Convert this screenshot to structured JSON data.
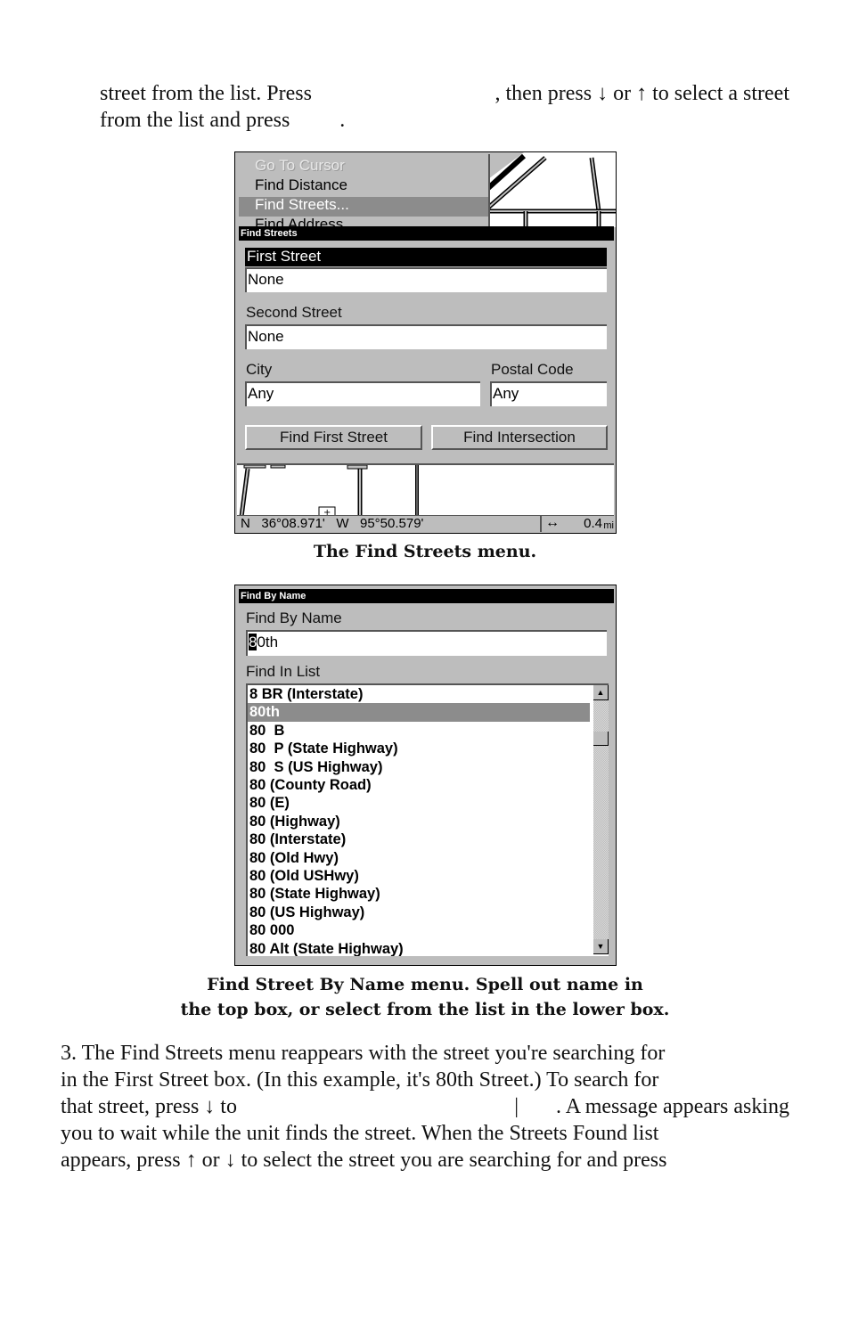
{
  "intro": {
    "line1_left": "street from the list. Press",
    "line1_right": ", then press ↓ or ↑ to select a street",
    "line2": "from the list and press",
    "line2_end": "."
  },
  "find_streets_screen": {
    "popup_menu": {
      "items": [
        {
          "label": "Go To Cursor",
          "state": "disabled"
        },
        {
          "label": "Find Distance",
          "state": "normal"
        },
        {
          "label": "Find Streets...",
          "state": "selected"
        },
        {
          "label": "Find Address",
          "state": "partially-hidden"
        }
      ]
    },
    "dialog_title": "Find Streets",
    "first_street_label": "First Street",
    "first_street_value": "None",
    "second_street_label": "Second Street",
    "second_street_value": "None",
    "city_label": "City",
    "city_value": "Any",
    "postal_code_label": "Postal Code",
    "postal_code_value": "Any",
    "find_first_street_button": "Find First Street",
    "find_intersection_button": "Find Intersection",
    "status": {
      "lat_hemisphere": "N",
      "latitude": "36°08.971'",
      "lon_hemisphere": "W",
      "longitude": "95°50.579'",
      "zoom_icon": "horizontal-double-arrow",
      "zoom_value": "0.4",
      "zoom_unit": "mi"
    }
  },
  "caption1": "The Find Streets menu.",
  "find_by_name_screen": {
    "dialog_title": "Find By Name",
    "find_by_name_label": "Find By Name",
    "find_by_name_cursor_char": "8",
    "find_by_name_rest": "0th",
    "find_in_list_label": "Find In List",
    "list_items": [
      "8 BR (Interstate)",
      "80th",
      "80  B",
      "80  P (State Highway)",
      "80  S (US Highway)",
      "80 (County Road)",
      "80 (E)",
      "80 (Highway)",
      "80 (Interstate)",
      "80 (Old Hwy)",
      "80 (Old USHwy)",
      "80 (State Highway)",
      "80 (US Highway)",
      "80 000",
      "80 Alt (State Highway)"
    ],
    "selected_index": 1,
    "scroll_up_icon": "▲",
    "scroll_down_icon": "▼"
  },
  "caption2_line1": "Find Street By Name menu. Spell out name in",
  "caption2_line2": "the top box, or select from the list in the lower box.",
  "step3": {
    "lines": [
      {
        "left": "3. The Find Streets menu reappears with the street you're searching for",
        "right": ""
      },
      {
        "left": "in the First Street box. (In this example, it's 80th Street.) To search for",
        "right": ""
      },
      {
        "left": "that street, press ↓ to",
        "right": "|       . A message appears asking"
      },
      {
        "left": "you to wait while the unit finds the street. When the Streets Found list",
        "right": ""
      },
      {
        "left": "appears, press ↑ or ↓ to select the street you are searching for and press",
        "right": ""
      }
    ]
  }
}
